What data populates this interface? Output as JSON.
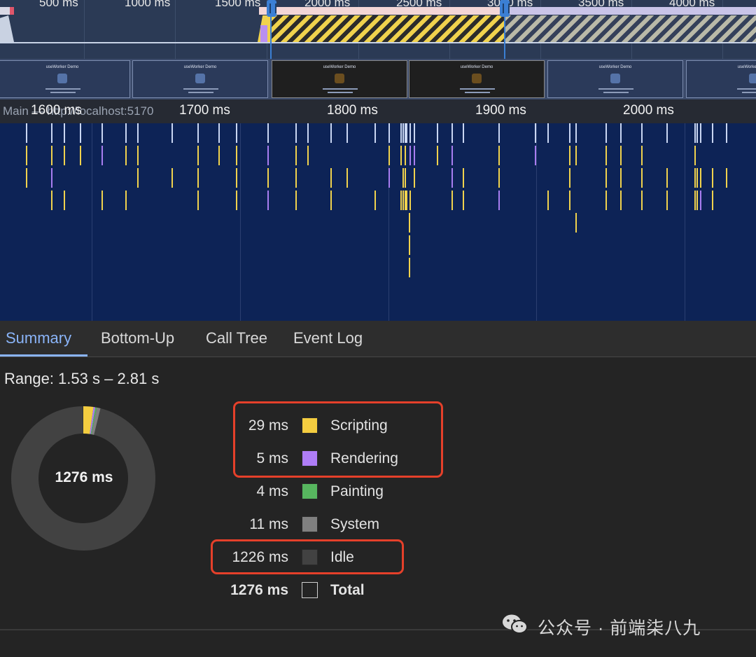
{
  "overview": {
    "tick_labels": [
      "500 ms",
      "1000 ms",
      "1500 ms",
      "2000 ms",
      "2500 ms",
      "3000 ms",
      "3500 ms",
      "4000 ms"
    ]
  },
  "filmstrip": {
    "frame_title": "useWorker Demo",
    "frame_count": 6
  },
  "ruler": {
    "track_title": "Main — http://localhost:5170",
    "labels": [
      "1600 ms",
      "1700 ms",
      "1800 ms",
      "1900 ms",
      "2000 ms"
    ]
  },
  "tabs": [
    {
      "label": "Summary",
      "active": true
    },
    {
      "label": "Bottom-Up",
      "active": false
    },
    {
      "label": "Call Tree",
      "active": false
    },
    {
      "label": "Event Log",
      "active": false
    }
  ],
  "summary": {
    "range": "Range: 1.53 s – 2.81 s",
    "total_center": "1276 ms",
    "categories": [
      {
        "value": "29 ms",
        "name": "Scripting",
        "color": "#f4cd40",
        "ms": 29
      },
      {
        "value": "5 ms",
        "name": "Rendering",
        "color": "#af7df7",
        "ms": 5
      },
      {
        "value": "4 ms",
        "name": "Painting",
        "color": "#57b65f",
        "ms": 4
      },
      {
        "value": "11 ms",
        "name": "System",
        "color": "#808080",
        "ms": 11
      },
      {
        "value": "1226 ms",
        "name": "Idle",
        "color": "#424242",
        "ms": 1226
      },
      {
        "value": "1276 ms",
        "name": "Total",
        "color": "#242424",
        "ms": 1276
      }
    ],
    "highlight_color": "#e5402a"
  },
  "watermark": {
    "text": "公众号 · 前端柒八九"
  }
}
